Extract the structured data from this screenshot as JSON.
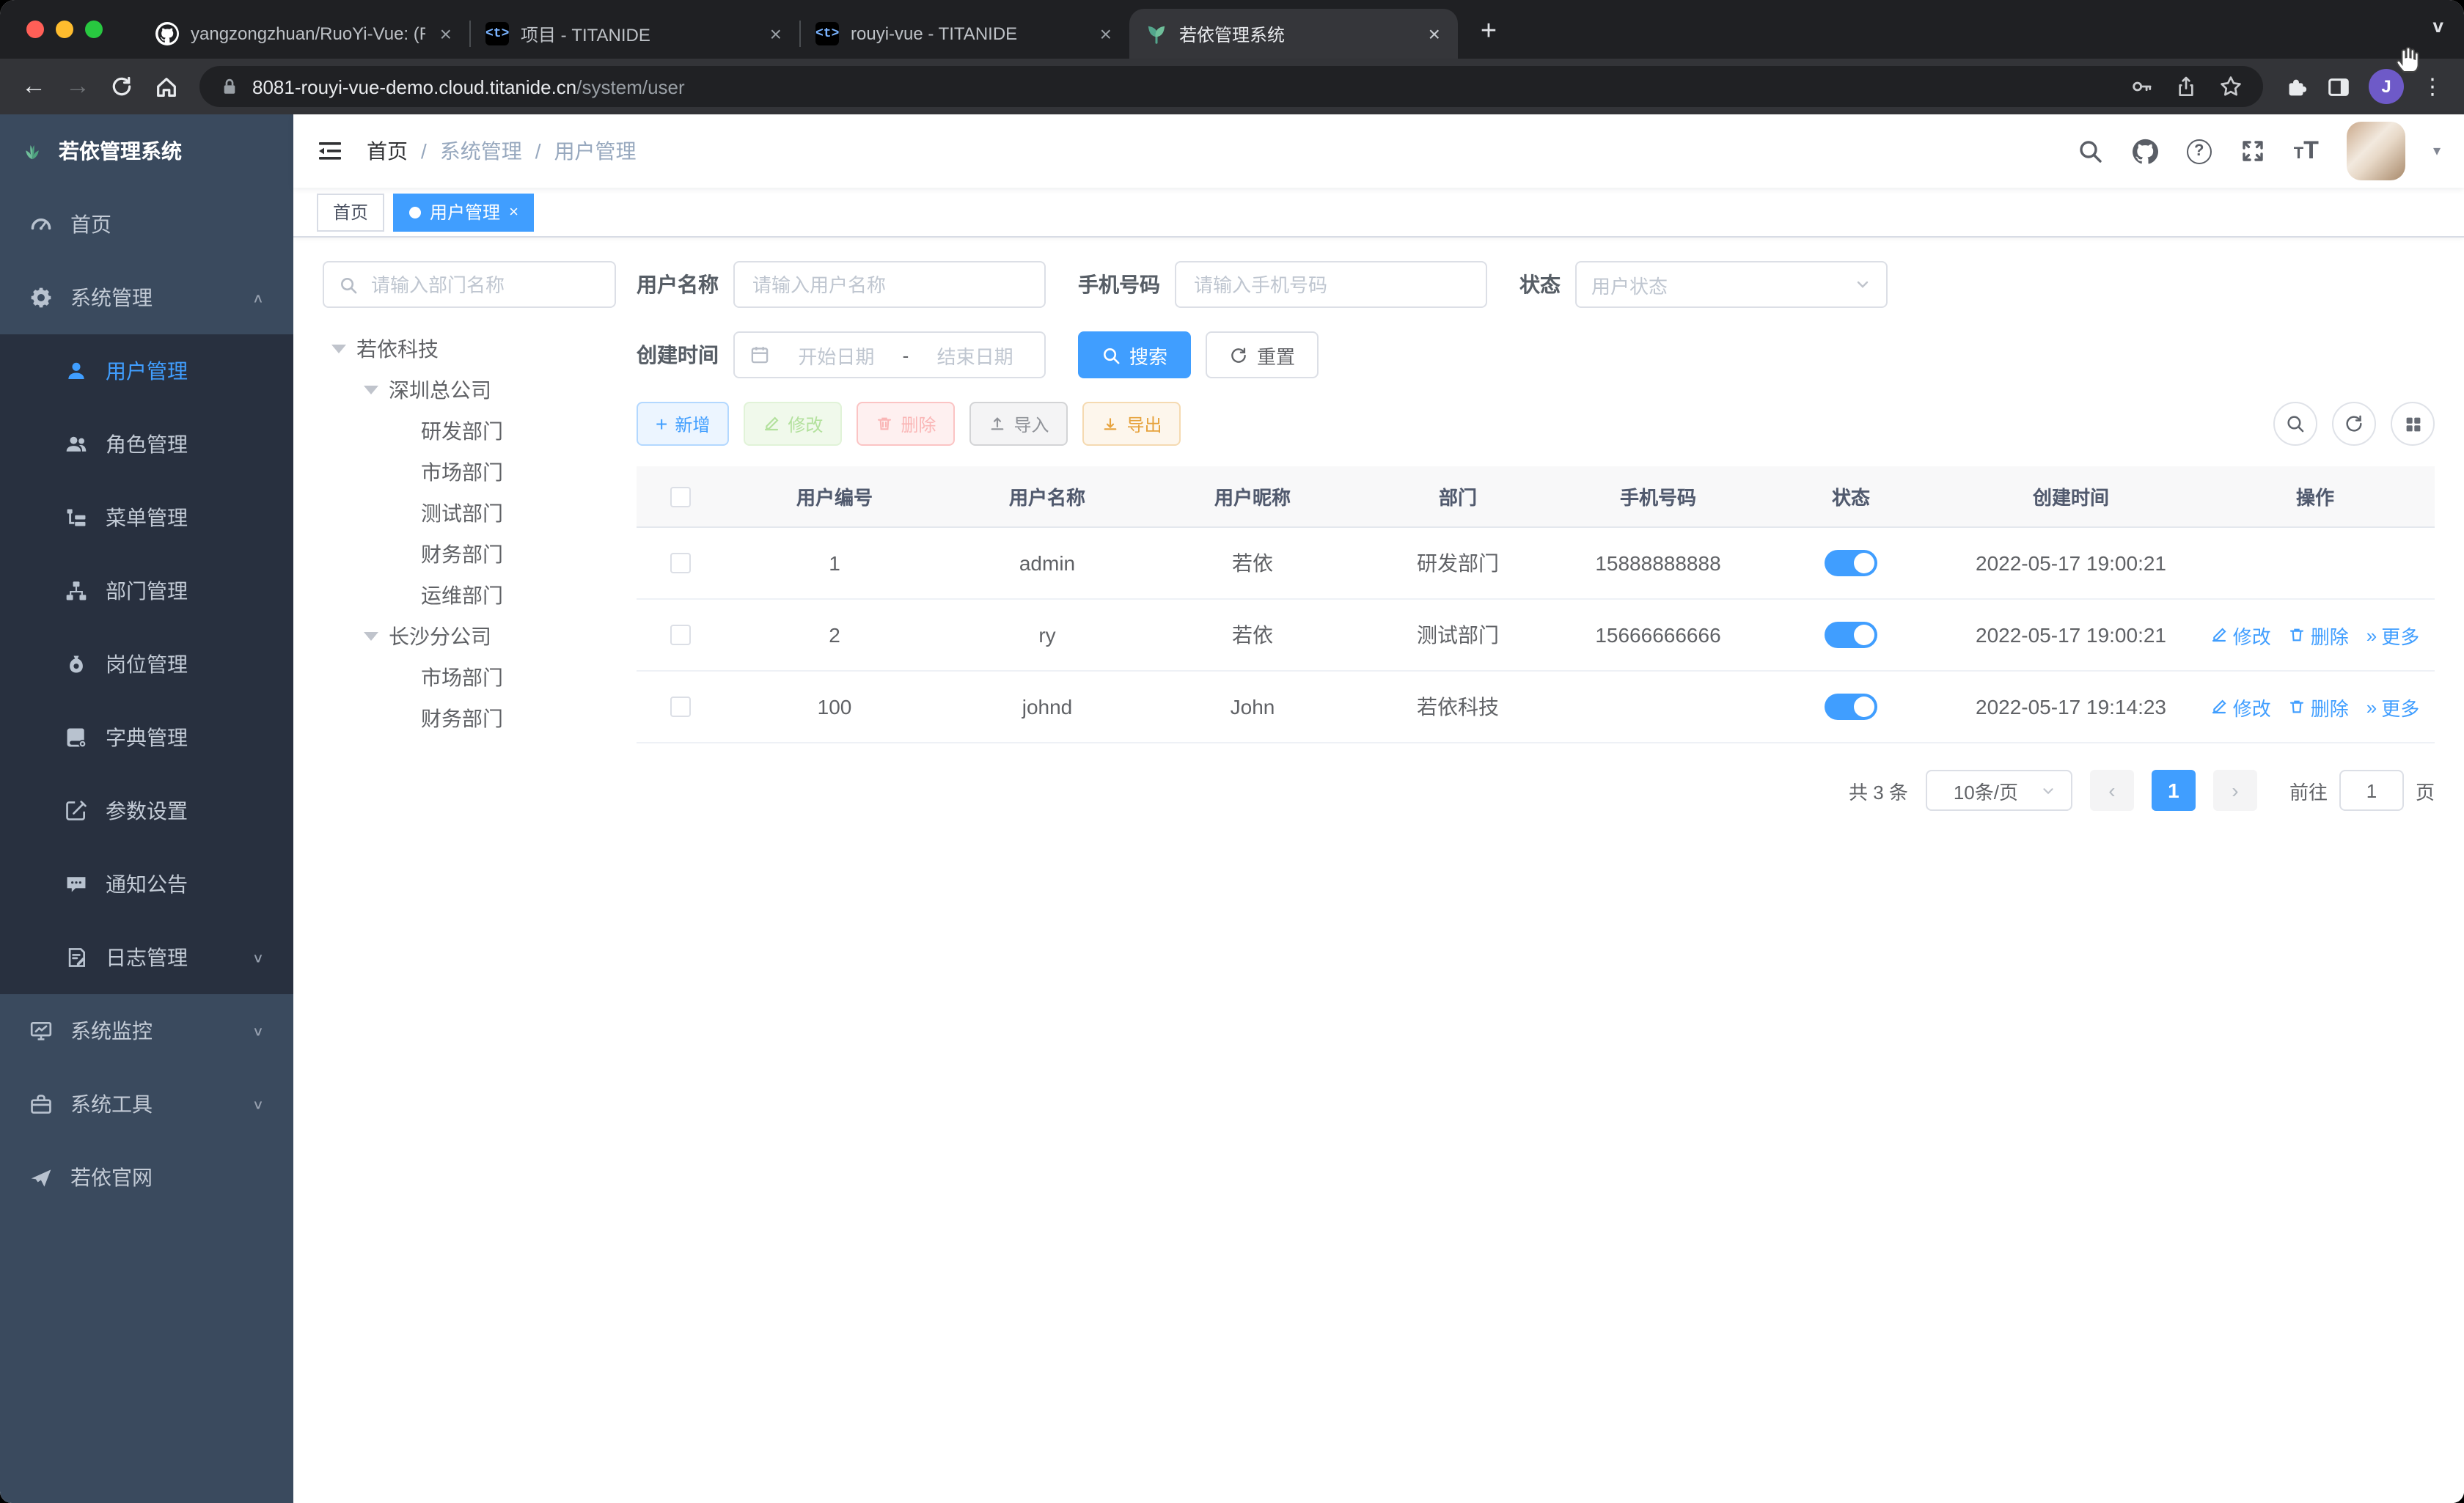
{
  "glyphs": {
    "close": "×",
    "plus": "+",
    "chevron_v": "v",
    "dots": "⋮",
    "back": "←",
    "forward": "→",
    "slash": "/",
    "more": "»",
    "prev": "‹",
    "next": "›",
    "question": "?",
    "font_T": "T",
    "caret_down": "▾",
    "chev_up": "∧",
    "chev_down": "∨"
  },
  "colors": {
    "accent": "#409eff",
    "success": "#67c23a",
    "danger": "#f56c6c",
    "warning": "#e6a23c",
    "info": "#909399",
    "sidebar": "#3a4a5e",
    "submenu": "#28303f"
  },
  "browser": {
    "tabs": [
      {
        "title": "yangzongzhuan/RuoYi-Vue: (Ru"
      },
      {
        "title": "项目 - TITANIDE"
      },
      {
        "title": "rouyi-vue - TITANIDE"
      },
      {
        "title": "若依管理系统"
      }
    ],
    "titanide_glyph": "<t>",
    "url_host": "8081-rouyi-vue-demo.cloud.titanide.cn",
    "url_path": "/system/user",
    "avatar_letter": "J"
  },
  "sidebar": {
    "logo_title": "若依管理系统",
    "home": "首页",
    "system": "系统管理",
    "sub": [
      "用户管理",
      "角色管理",
      "菜单管理",
      "部门管理",
      "岗位管理",
      "字典管理",
      "参数设置",
      "通知公告",
      "日志管理"
    ],
    "monitor": "系统监控",
    "tools": "系统工具",
    "site": "若依官网"
  },
  "navbar": {
    "breadcrumb": [
      "首页",
      "系统管理",
      "用户管理"
    ]
  },
  "tags": [
    {
      "label": "首页"
    },
    {
      "label": "用户管理"
    }
  ],
  "tree": {
    "search_placeholder": "请输入部门名称",
    "nodes": [
      {
        "label": "若依科技",
        "depth": 0,
        "caret": true
      },
      {
        "label": "深圳总公司",
        "depth": 1,
        "caret": true
      },
      {
        "label": "研发部门",
        "depth": 2,
        "caret": false
      },
      {
        "label": "市场部门",
        "depth": 2,
        "caret": false
      },
      {
        "label": "测试部门",
        "depth": 2,
        "caret": false
      },
      {
        "label": "财务部门",
        "depth": 2,
        "caret": false
      },
      {
        "label": "运维部门",
        "depth": 2,
        "caret": false
      },
      {
        "label": "长沙分公司",
        "depth": 1,
        "caret": true
      },
      {
        "label": "市场部门",
        "depth": 2,
        "caret": false
      },
      {
        "label": "财务部门",
        "depth": 2,
        "caret": false
      }
    ]
  },
  "filters": {
    "username_label": "用户名称",
    "username_placeholder": "请输入用户名称",
    "phone_label": "手机号码",
    "phone_placeholder": "请输入手机号码",
    "status_label": "状态",
    "status_placeholder": "用户状态",
    "created_label": "创建时间",
    "date_start": "开始日期",
    "date_sep": "-",
    "date_end": "结束日期",
    "search_btn": "搜索",
    "reset_btn": "重置"
  },
  "toolbar": {
    "add": "新增",
    "edit": "修改",
    "delete": "删除",
    "import": "导入",
    "export": "导出"
  },
  "table": {
    "columns": [
      "用户编号",
      "用户名称",
      "用户昵称",
      "部门",
      "手机号码",
      "状态",
      "创建时间",
      "操作"
    ],
    "ops": {
      "edit": "修改",
      "delete": "删除",
      "more": "更多"
    },
    "rows": [
      {
        "id": "1",
        "username": "admin",
        "nickname": "若依",
        "dept": "研发部门",
        "phone": "15888888888",
        "created": "2022-05-17 19:00:21"
      },
      {
        "id": "2",
        "username": "ry",
        "nickname": "若依",
        "dept": "测试部门",
        "phone": "15666666666",
        "created": "2022-05-17 19:00:21"
      },
      {
        "id": "100",
        "username": "johnd",
        "nickname": "John",
        "dept": "若依科技",
        "phone": "",
        "created": "2022-05-17 19:14:23"
      }
    ]
  },
  "pagination": {
    "total": "共 3 条",
    "size": "10条/页",
    "page": "1",
    "goto_prefix": "前往",
    "goto_value": "1",
    "goto_suffix": "页"
  }
}
